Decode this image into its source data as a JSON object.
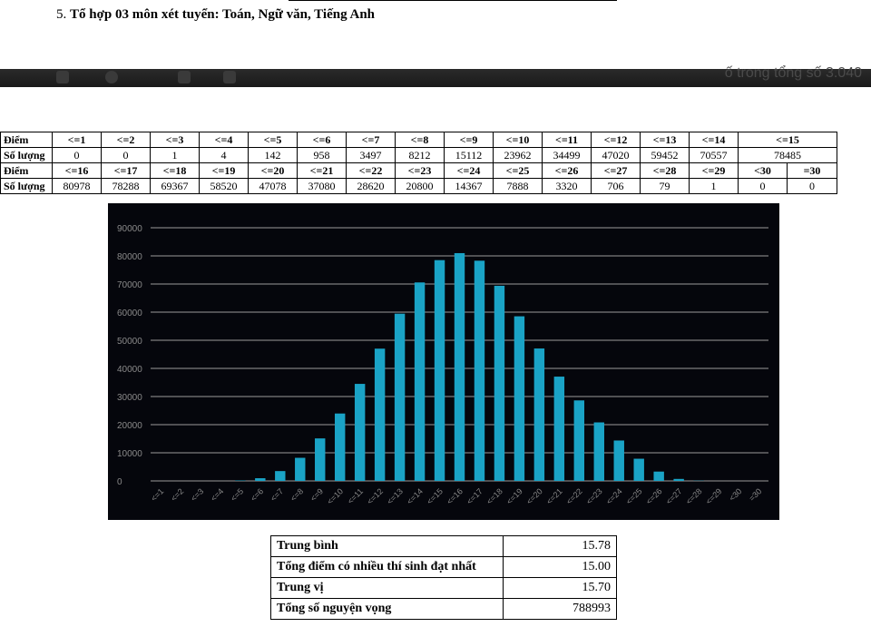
{
  "heading": {
    "number": "5.",
    "text": "Tổ hợp 03 môn xét tuyển: Toán, Ngữ văn, Tiếng Anh"
  },
  "background_text": "ố trong tổng số 3.040",
  "table": {
    "row_labels": {
      "score": "Điểm",
      "count": "Số lượng"
    },
    "row1_headers": [
      "<=1",
      "<=2",
      "<=3",
      "<=4",
      "<=5",
      "<=6",
      "<=7",
      "<=8",
      "<=9",
      "<=10",
      "<=11",
      "<=12",
      "<=13",
      "<=14",
      "<=15"
    ],
    "row1_values": [
      "0",
      "0",
      "1",
      "4",
      "142",
      "958",
      "3497",
      "8212",
      "15112",
      "23962",
      "34499",
      "47020",
      "59452",
      "70557",
      "78485"
    ],
    "row2_headers": [
      "<=16",
      "<=17",
      "<=18",
      "<=19",
      "<=20",
      "<=21",
      "<=22",
      "<=23",
      "<=24",
      "<=25",
      "<=26",
      "<=27",
      "<=28",
      "<=29",
      "<30",
      "=30"
    ],
    "row2_values": [
      "80978",
      "78288",
      "69367",
      "58520",
      "47078",
      "37080",
      "28620",
      "20800",
      "14367",
      "7888",
      "3320",
      "706",
      "79",
      "1",
      "0",
      "0"
    ]
  },
  "chart_data": {
    "type": "bar",
    "categories": [
      "<=1",
      "<=2",
      "<=3",
      "<=4",
      "<=5",
      "<=6",
      "<=7",
      "<=8",
      "<=9",
      "<=10",
      "<=11",
      "<=12",
      "<=13",
      "<=14",
      "<=15",
      "<=16",
      "<=17",
      "<=18",
      "<=19",
      "<=20",
      "<=21",
      "<=22",
      "<=23",
      "<=24",
      "<=25",
      "<=26",
      "<=27",
      "<=28",
      "<=29",
      "<30",
      "=30"
    ],
    "values": [
      0,
      0,
      1,
      4,
      142,
      958,
      3497,
      8212,
      15112,
      23962,
      34499,
      47020,
      59452,
      70557,
      78485,
      80978,
      78288,
      69367,
      58520,
      47078,
      37080,
      28620,
      20800,
      14367,
      7888,
      3320,
      706,
      79,
      1,
      0,
      0
    ],
    "yticks": [
      "0",
      "10000",
      "20000",
      "30000",
      "40000",
      "50000",
      "60000",
      "70000",
      "80000",
      "90000"
    ],
    "ylim": [
      0,
      90000
    ],
    "grid": true,
    "colors": {
      "bar": "#1aa3c6",
      "background": "#05060c",
      "grid": "#9a9a9a",
      "text": "#8a8a8a"
    }
  },
  "summary": [
    {
      "label": "Trung bình",
      "value": "15.78"
    },
    {
      "label": "Tổng điểm có nhiều thí sinh đạt nhất",
      "value": "15.00"
    },
    {
      "label": "Trung vị",
      "value": "15.70"
    },
    {
      "label": "Tổng số nguyện vọng",
      "value": "788993"
    }
  ]
}
